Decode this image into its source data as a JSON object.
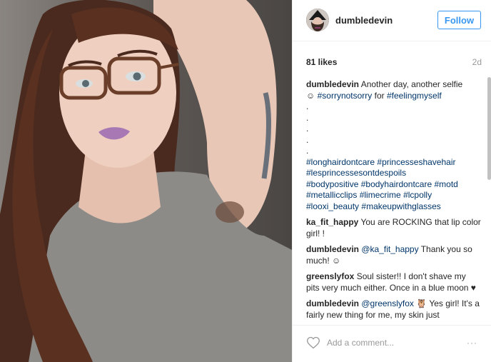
{
  "header": {
    "username": "dumbledevin",
    "follow_label": "Follow"
  },
  "meta": {
    "likes": "81 likes",
    "age": "2d"
  },
  "caption": {
    "username": "dumbledevin",
    "text1": "Another day, another selfie",
    "emoji": "☺",
    "tag1": "#sorrynotsorry",
    "for_text": "for",
    "tag2": "#feelingmyself",
    "dots": [
      ".",
      ".",
      ".",
      ".",
      "."
    ],
    "tags_line1a": "#longhairdontcare",
    "tags_line1b": "#princesseshavehair",
    "tags_line2": "#lesprincessesontdespoils",
    "tags_line3a": "#bodypositive",
    "tags_line3b": "#bodyhairdontcare",
    "tags_line3c": "#motd",
    "tags_line4a": "#metallicclips",
    "tags_line4b": "#limecrime",
    "tags_line4c": "#lcpolly",
    "tags_line5a": "#looxi_beauty",
    "tags_line5b": "#makeupwithglasses"
  },
  "comments": [
    {
      "user": "ka_fit_happy",
      "text": "You are ROCKING that lip color girl! !"
    },
    {
      "user": "dumbledevin",
      "mention": "@ka_fit_happy",
      "text": "Thank you so much! ☺"
    },
    {
      "user": "greenslyfox",
      "text": "Soul sister!! I don't shave my pits very much either. Once in a blue moon ♥"
    },
    {
      "user": "dumbledevin",
      "mention": "@greenslyfox",
      "emoji": "🦉",
      "text": "Yes girl! It's a fairly new thing for me, my skin just"
    }
  ],
  "footer": {
    "placeholder": "Add a comment...",
    "more": "···"
  },
  "colors": {
    "accent": "#3897f0",
    "tag": "#003569",
    "muted": "#999999"
  }
}
